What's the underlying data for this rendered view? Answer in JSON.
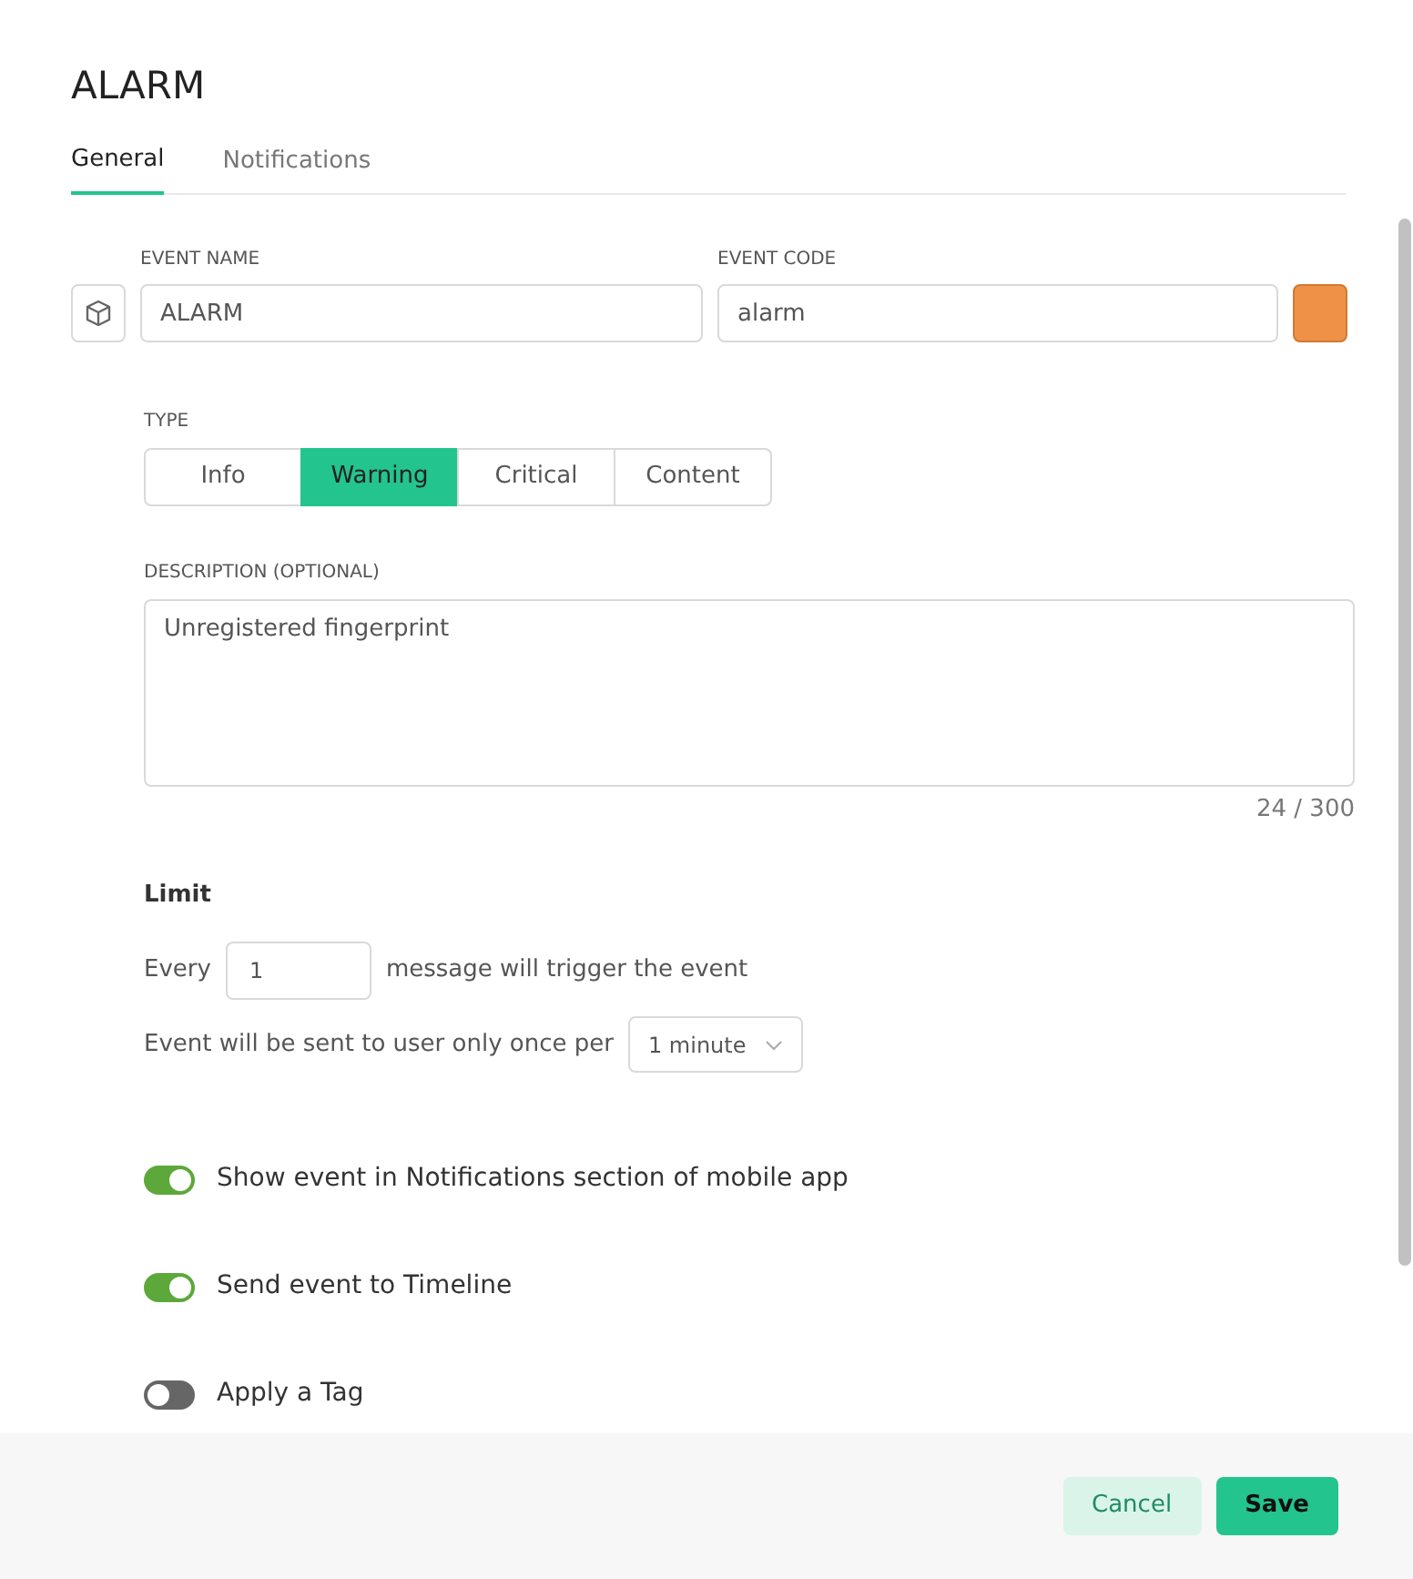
{
  "dialog": {
    "title": "ALARM"
  },
  "tabs": [
    {
      "label": "General",
      "selected": true
    },
    {
      "label": "Notifications",
      "selected": false
    }
  ],
  "event_name": {
    "label": "EVENT NAME",
    "value": "ALARM"
  },
  "event_code": {
    "label": "EVENT CODE",
    "value": "alarm",
    "color": "#ef9146"
  },
  "type": {
    "label": "TYPE",
    "options": [
      {
        "label": "Info",
        "selected": false
      },
      {
        "label": "Warning",
        "selected": true
      },
      {
        "label": "Critical",
        "selected": false
      },
      {
        "label": "Content",
        "selected": false
      }
    ]
  },
  "description": {
    "label": "DESCRIPTION (OPTIONAL)",
    "value": "Unregistered fingerprint",
    "counter": "24 / 300"
  },
  "limit": {
    "heading": "Limit",
    "every_label": "Every",
    "every_value": "1",
    "every_suffix": "message will trigger the event",
    "once_label": "Event will be sent to user only once per",
    "once_value": "1 minute"
  },
  "toggles": [
    {
      "label": "Show event in Notifications section of mobile app",
      "on": true
    },
    {
      "label": "Send event to Timeline",
      "on": true
    },
    {
      "label": "Apply a Tag",
      "on": false
    }
  ],
  "buttons": [
    {
      "label": "Cancel",
      "kind": "secondary"
    },
    {
      "label": "Save",
      "kind": "primary"
    }
  ]
}
